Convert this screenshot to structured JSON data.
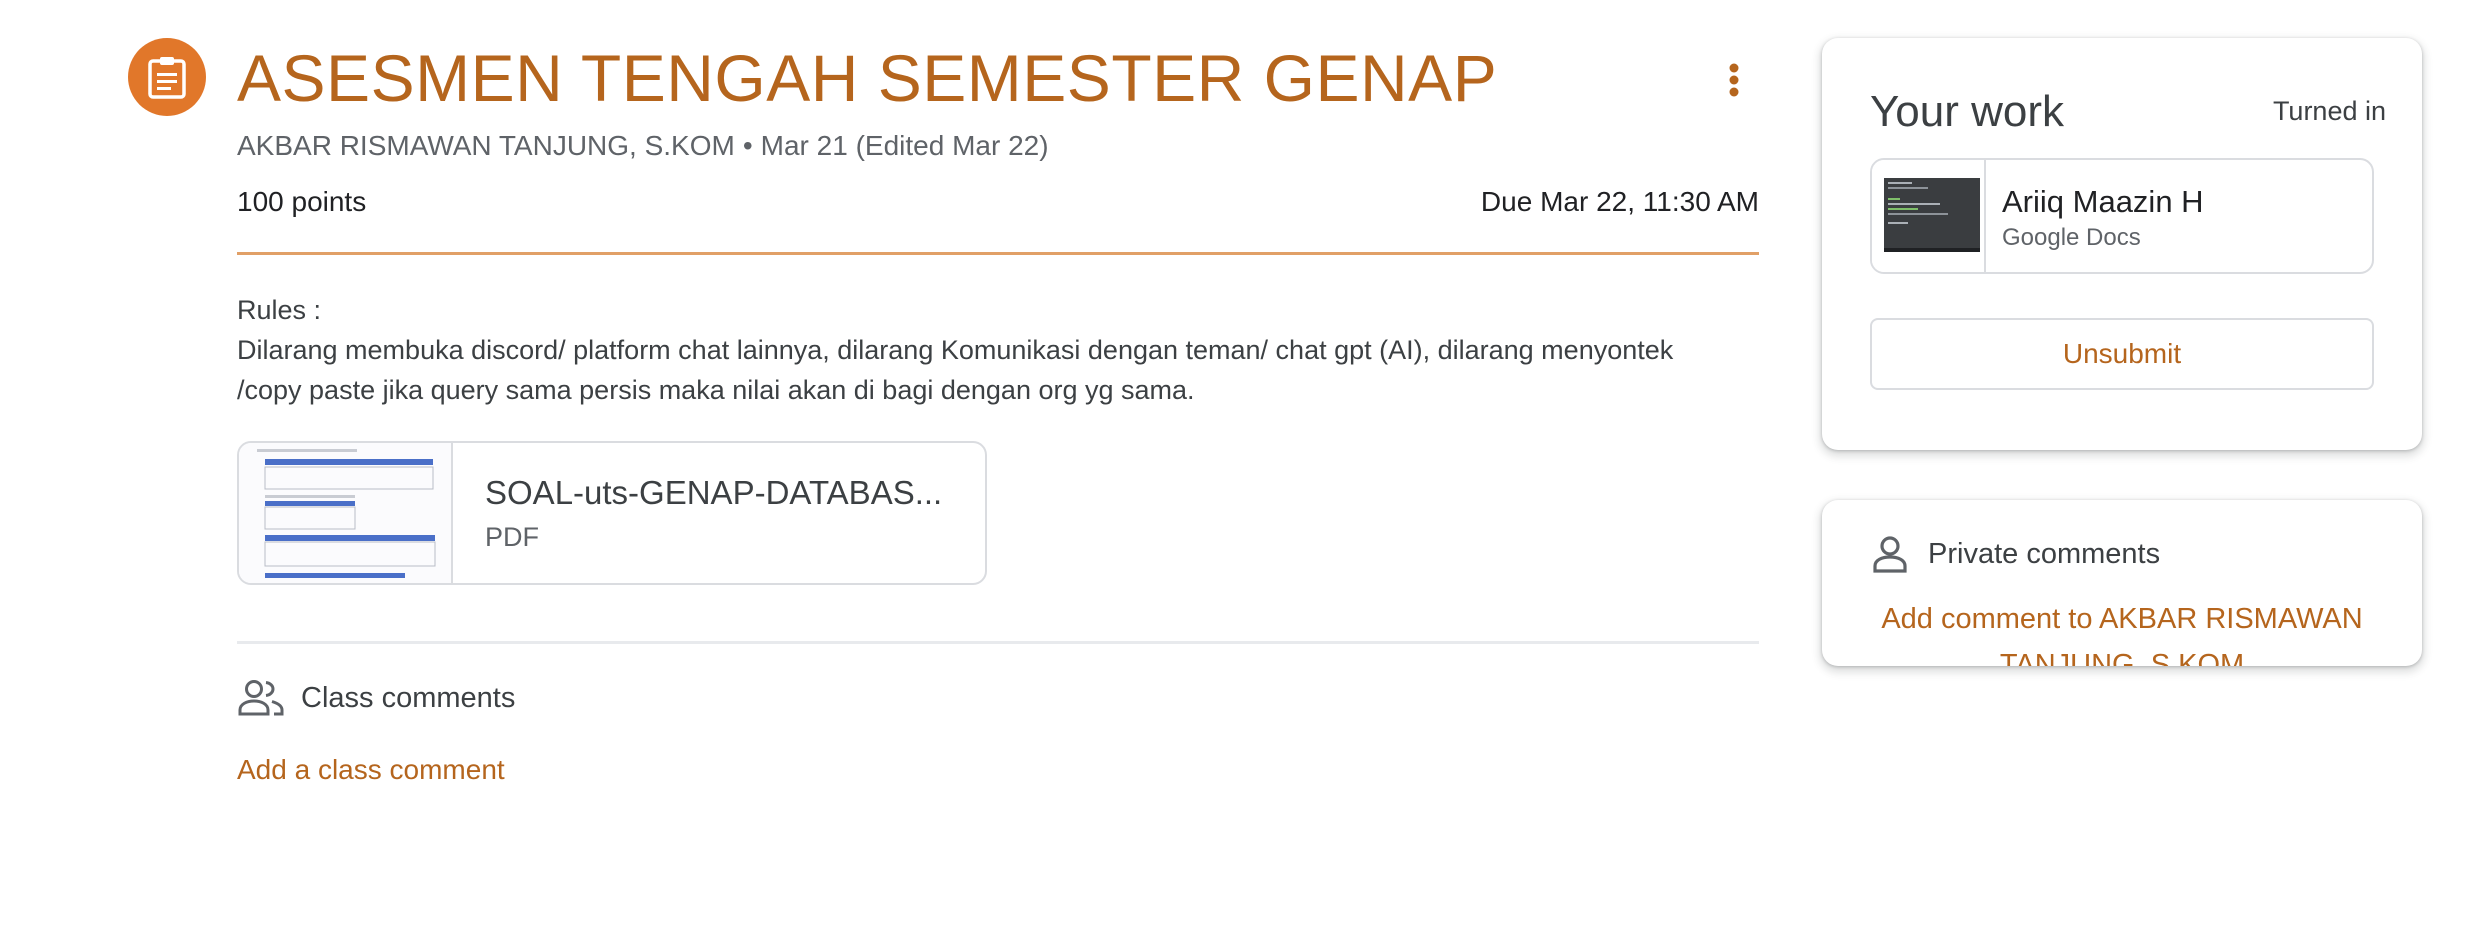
{
  "assignment": {
    "icon": "assignment-icon",
    "title": "ASESMEN TENGAH SEMESTER GENAP",
    "author": "AKBAR RISMAWAN TANJUNG, S.KOM",
    "separator": "•",
    "posted": "Mar 21 (Edited Mar 22)",
    "points": "100 points",
    "due": "Due Mar 22, 11:30 AM",
    "description": [
      "Rules :",
      "Dilarang membuka discord/ platform chat lainnya, dilarang Komunikasi dengan teman/ chat gpt (AI), dilarang menyontek /copy paste jika query sama persis maka nilai akan di bagi dengan org yg sama."
    ],
    "attachment": {
      "name": "SOAL-uts-GENAP-DATABAS...",
      "type": "PDF"
    }
  },
  "class_comments": {
    "icon": "people-icon",
    "label": "Class comments",
    "add_label": "Add a class comment"
  },
  "your_work": {
    "title": "Your work",
    "status": "Turned in",
    "file": {
      "name": "Ariiq Maazin H",
      "type": "Google Docs"
    },
    "unsubmit_label": "Unsubmit"
  },
  "private_comments": {
    "icon": "person-icon",
    "label": "Private comments",
    "add_label": "Add comment to AKBAR RISMAWAN TANJUNG, S.KOM"
  },
  "colors": {
    "accent": "#b5651d",
    "icon_bg": "#e1772a",
    "divider_accent": "#e1a067"
  }
}
